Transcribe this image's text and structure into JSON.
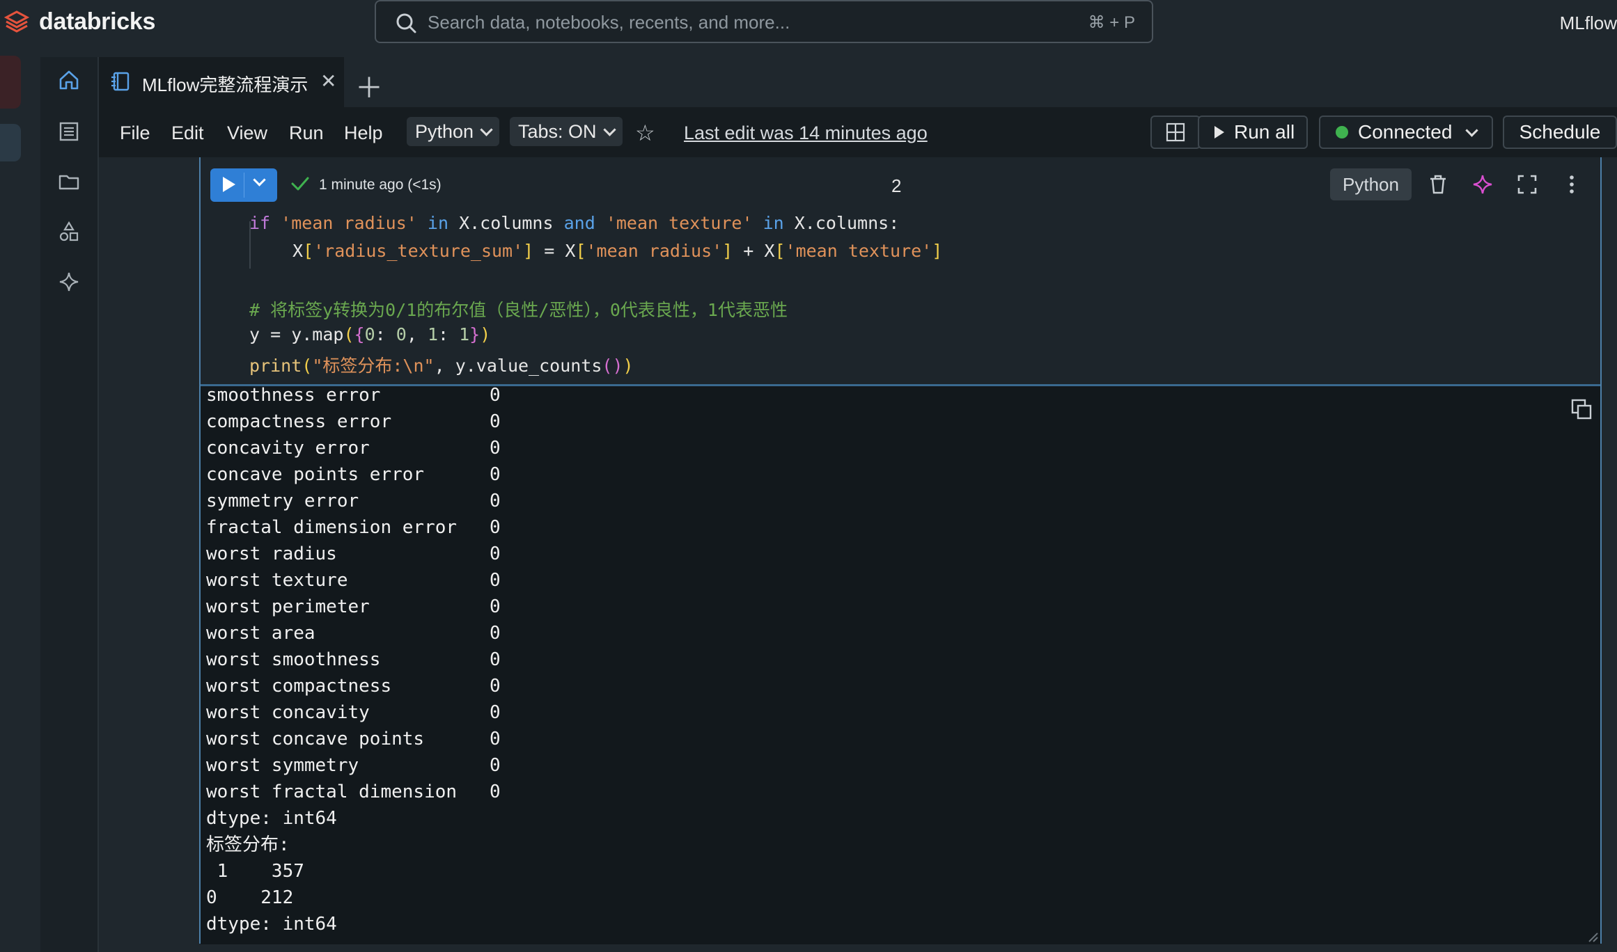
{
  "topbar": {
    "brand": "databricks",
    "search_placeholder": "Search data, notebooks, recents, and more...",
    "search_shortcut": "⌘ + P",
    "workspace": "MLflow"
  },
  "tab": {
    "title": "MLflow完整流程演示"
  },
  "menu": {
    "items": [
      "File",
      "Edit",
      "View",
      "Run",
      "Help"
    ],
    "language": "Python",
    "tabs_mode": "Tabs: ON",
    "last_edit": "Last edit was 14 minutes ago",
    "run_all": "Run all",
    "connection": "Connected",
    "schedule": "Schedule"
  },
  "cell": {
    "status_time": "1 minute ago (<1s)",
    "number": "2",
    "language": "Python"
  },
  "output_lines": [
    "smoothness error          0",
    "compactness error         0",
    "concavity error           0",
    "concave points error      0",
    "symmetry error            0",
    "fractal dimension error   0",
    "worst radius              0",
    "worst texture             0",
    "worst perimeter           0",
    "worst area                0",
    "worst smoothness          0",
    "worst compactness         0",
    "worst concavity           0",
    "worst concave points      0",
    "worst symmetry            0",
    "worst fractal dimension   0",
    "dtype: int64",
    "标签分布:",
    " 1    357",
    "0    212",
    "dtype: int64"
  ],
  "colors": {
    "accent": "#2f7fd6",
    "connected": "#3fb24f",
    "logo": "#e5533d",
    "ai_star": "#d94fd0"
  },
  "icons": {
    "sidebar": [
      "home-icon",
      "catalog-icon",
      "folder-icon",
      "shapes-icon",
      "sparkle-icon"
    ],
    "toolbar": [
      "layout-icon",
      "play-icon",
      "status-dot-icon",
      "star-icon"
    ],
    "cell": [
      "trash-icon",
      "ai-assistant-icon",
      "expand-icon",
      "more-icon",
      "copy-icon"
    ]
  }
}
